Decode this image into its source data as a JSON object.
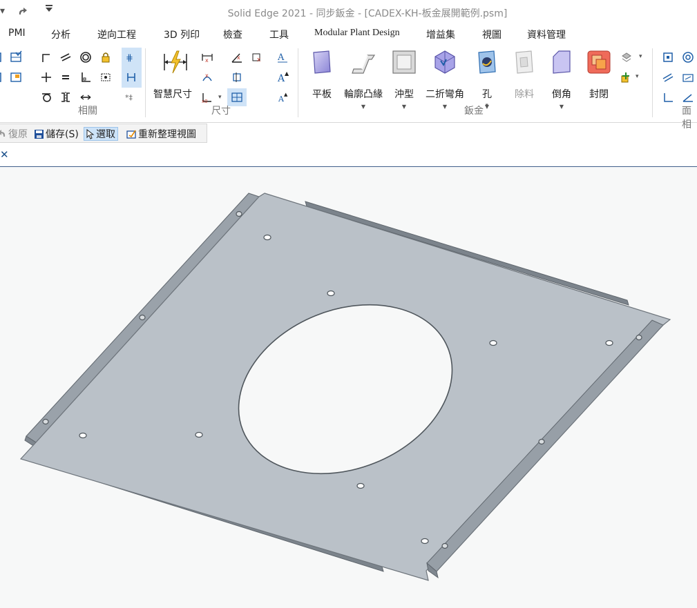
{
  "window": {
    "title": "Solid Edge 2021 - 同步鈑金 - [CADEX-KH-板金展開範例.psm]"
  },
  "quick_access": {
    "redo_icon": "redo-icon",
    "customize_icon": "customize-quick-access-icon"
  },
  "menu": {
    "tabs": [
      "PMI",
      "分析",
      "逆向工程",
      "3D 列印",
      "檢查",
      "工具",
      "Modular Plant Design",
      "增益集",
      "視圖",
      "資料管理"
    ]
  },
  "ribbon": {
    "groups": {
      "relate": "相關",
      "dimension": "尺寸",
      "sheetmetal": "鈑金",
      "face": "面相"
    },
    "smart_dimension_label": "智慧尺寸",
    "sheetmetal_buttons": [
      {
        "label": "平板",
        "icon": "tab-plate-icon",
        "caret": false,
        "enabled": true
      },
      {
        "label": "輪廓凸緣",
        "icon": "contour-flange-icon",
        "caret": true,
        "enabled": true
      },
      {
        "label": "沖型",
        "icon": "dimple-icon",
        "caret": true,
        "enabled": true
      },
      {
        "label": "二折彎角",
        "icon": "two-bend-corner-icon",
        "caret": true,
        "enabled": true
      },
      {
        "label": "孔",
        "icon": "hole-icon",
        "caret": true,
        "enabled": true
      },
      {
        "label": "除料",
        "icon": "cutout-icon",
        "caret": false,
        "enabled": false
      },
      {
        "label": "倒角",
        "icon": "chamfer-icon",
        "caret": true,
        "enabled": true
      },
      {
        "label": "封閉",
        "icon": "close-corner-icon",
        "caret": false,
        "enabled": true
      }
    ]
  },
  "command_bar": {
    "undo": "復原",
    "save": "儲存(S)",
    "select": "選取",
    "refresh": "重新整理視圖"
  },
  "doc_tab": {
    "close_icon": "close-icon"
  },
  "colors": {
    "plate_face": "#b8bfc6",
    "plate_edge": "#6d747b",
    "flange_dark": "#8f979f",
    "viewport_bg": "#f7f8f8",
    "highlight": "#cfe3f7"
  }
}
